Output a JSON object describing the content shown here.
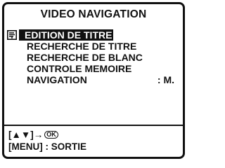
{
  "title": "VIDEO NAVIGATION",
  "menu": {
    "items": [
      {
        "label": "EDITION DE TITRE",
        "value": "",
        "selected": true
      },
      {
        "label": "RECHERCHE DE TITRE",
        "value": "",
        "selected": false
      },
      {
        "label": "RECHERCHE DE BLANC",
        "value": "",
        "selected": false
      },
      {
        "label": "CONTROLE MEMOIRE",
        "value": "",
        "selected": false
      },
      {
        "label": "NAVIGATION",
        "value": ": M.",
        "selected": false
      }
    ]
  },
  "footer": {
    "nav_keys": "[▲▼]→",
    "ok_label": "OK",
    "exit_hint": "[MENU] : SORTIE"
  },
  "icons": {
    "cursor": "pointing-hand-icon",
    "ok": "ok-button-icon"
  },
  "colors": {
    "ink": "#111111",
    "background": "#ffffff",
    "highlight_text": "#ffffff"
  }
}
